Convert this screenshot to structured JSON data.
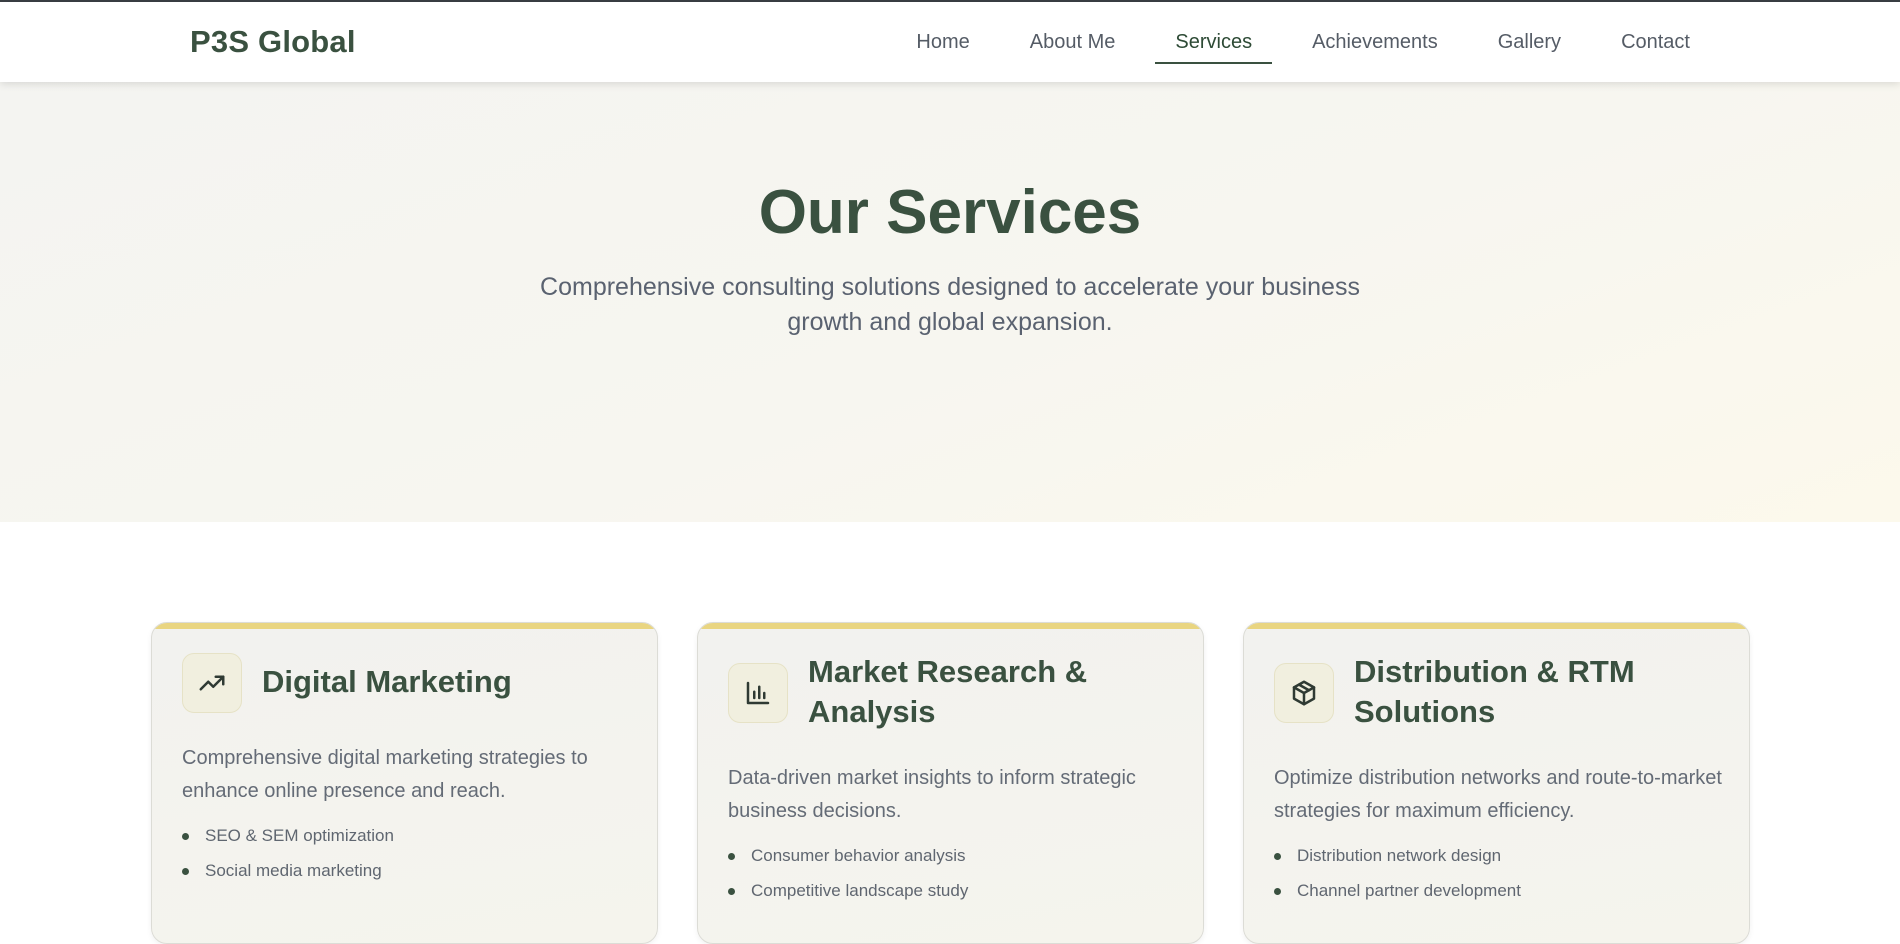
{
  "header": {
    "logo": "P3S Global",
    "nav": [
      "Home",
      "About Me",
      "Services",
      "Achievements",
      "Gallery",
      "Contact"
    ],
    "active_nav": "Services"
  },
  "hero": {
    "title": "Our Services",
    "subtitle": "Comprehensive consulting solutions designed to accelerate your business growth and global expansion."
  },
  "services": [
    {
      "icon": "trending-up-icon",
      "title": "Digital Marketing",
      "description": "Comprehensive digital marketing strategies to enhance online presence and reach.",
      "features": [
        "SEO & SEM optimization",
        "Social media marketing"
      ]
    },
    {
      "icon": "bar-chart-icon",
      "title": "Market Research & Analysis",
      "description": "Data-driven market insights to inform strategic business decisions.",
      "features": [
        "Consumer behavior analysis",
        "Competitive landscape study"
      ]
    },
    {
      "icon": "package-icon",
      "title": "Distribution & RTM Solutions",
      "description": "Optimize distribution networks and route-to-market strategies for maximum efficiency.",
      "features": [
        "Distribution network design",
        "Channel partner development"
      ]
    }
  ],
  "colors": {
    "brand": "#3a5140",
    "accent": "#e9d581",
    "text_muted": "#646b76"
  }
}
